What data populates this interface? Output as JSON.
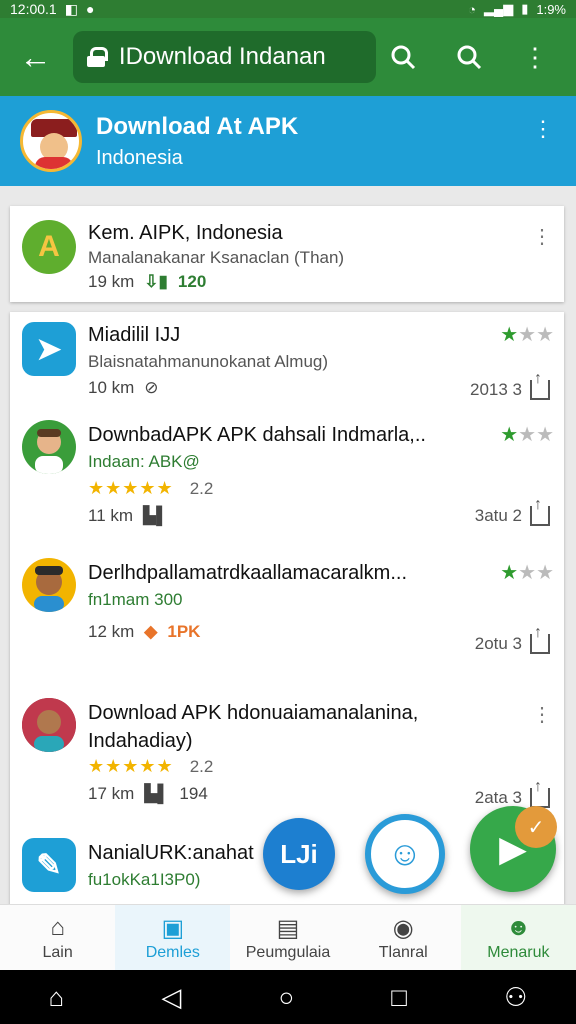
{
  "status": {
    "time": "12:00.1",
    "battery": "1:9%"
  },
  "header": {
    "search_text": "IDownload Indanan"
  },
  "banner": {
    "title": "Download At APK",
    "subtitle": "Indonesia"
  },
  "items": [
    {
      "title": "Kem. AIPK, Indonesia",
      "subtitle": "Manalanakanar Ksanaclan (Than)",
      "distance": "19 km",
      "extra": "120",
      "icon_color": "#5fae2e",
      "icon_glyph": "A"
    },
    {
      "title": "Miadilil IJJ",
      "subtitle": "Blaisnatahmanunokanat Almug)",
      "distance": "10 km",
      "date": "2013 3",
      "icon_color": "#1e9fd6",
      "icon_glyph": "➤",
      "star_filled": "★",
      "star_empty": "★★"
    },
    {
      "title": "DownbadAPK APK dahsali Indmarla,..",
      "subtitle": "Indaan: ABK@",
      "stars": "★★★★★",
      "rating": "2.2",
      "distance": "11 km",
      "date": "3atu 2",
      "icon_color": "#3a9d3a",
      "star_filled": "★",
      "star_empty": "★★"
    },
    {
      "title": "Derlhdpallamatrdkaallamacaralkm...",
      "subtitle": "fn1mam 300",
      "distance": "12 km",
      "extra": "1PK",
      "date": "2otu 3",
      "icon_color": "#f2b400",
      "star_filled": "★",
      "star_empty": "★★"
    },
    {
      "title": "Download APK hdonuaiamanalanina,",
      "subtitle": "Indahadiay)",
      "stars": "★★★★★",
      "rating": "2.2",
      "distance": "17 km",
      "extra": "194",
      "date": "2ata 3",
      "icon_color": "#8b2e3a"
    },
    {
      "title": "NanialURK:anahat",
      "subtitle": "fu1okKa1I3P0)",
      "icon_color": "#1e9fd6",
      "icon_glyph": "✎"
    }
  ],
  "fabs": {
    "fab1": "LJi",
    "fab2": "☺",
    "fab3": "▶",
    "badge": "✓"
  },
  "bottom_nav": [
    {
      "label": "Lain",
      "icon": "home-icon"
    },
    {
      "label": "Demles",
      "icon": "profile-icon"
    },
    {
      "label": "Peumgulaia",
      "icon": "grid-icon"
    },
    {
      "label": "Tlanral",
      "icon": "location-icon"
    },
    {
      "label": "Menaruk",
      "icon": "people-icon"
    }
  ]
}
